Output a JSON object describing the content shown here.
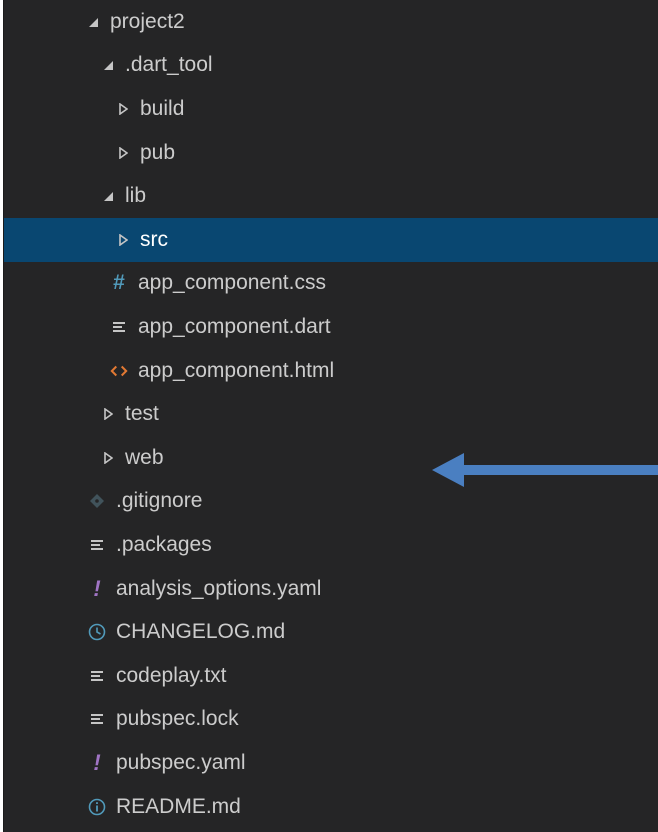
{
  "explorer": {
    "items": [
      {
        "label": "project2",
        "kind": "folder-open",
        "depth": 0
      },
      {
        "label": ".dart_tool",
        "kind": "folder-open",
        "depth": 1
      },
      {
        "label": "build",
        "kind": "folder-closed",
        "depth": 2
      },
      {
        "label": "pub",
        "kind": "folder-closed",
        "depth": 2
      },
      {
        "label": "lib",
        "kind": "folder-open",
        "depth": 1
      },
      {
        "label": "src",
        "kind": "folder-closed",
        "depth": 2,
        "selected": true
      },
      {
        "label": "app_component.css",
        "kind": "file",
        "icon": "hash-icon",
        "depth": 2
      },
      {
        "label": "app_component.dart",
        "kind": "file",
        "icon": "lines-icon",
        "depth": 2
      },
      {
        "label": "app_component.html",
        "kind": "file",
        "icon": "code-brackets-icon",
        "depth": 2
      },
      {
        "label": "test",
        "kind": "folder-closed",
        "depth": 1
      },
      {
        "label": "web",
        "kind": "folder-closed",
        "depth": 1
      },
      {
        "label": ".gitignore",
        "kind": "file",
        "icon": "git-diamond-icon",
        "depth": 1
      },
      {
        "label": ".packages",
        "kind": "file",
        "icon": "lines-icon",
        "depth": 1
      },
      {
        "label": "analysis_options.yaml",
        "kind": "file",
        "icon": "exclamation-icon",
        "depth": 1
      },
      {
        "label": "CHANGELOG.md",
        "kind": "file",
        "icon": "clock-icon",
        "depth": 1
      },
      {
        "label": "codeplay.txt",
        "kind": "file",
        "icon": "lines-icon",
        "depth": 1
      },
      {
        "label": "pubspec.lock",
        "kind": "file",
        "icon": "lines-icon",
        "depth": 1
      },
      {
        "label": "pubspec.yaml",
        "kind": "file",
        "icon": "exclamation-icon",
        "depth": 1
      },
      {
        "label": "README.md",
        "kind": "file",
        "icon": "info-icon",
        "depth": 1
      }
    ]
  },
  "colors": {
    "background": "#252526",
    "selection": "#094771",
    "text": "#cccccc",
    "css_icon": "#519aba",
    "html_icon": "#e37933",
    "yaml_icon": "#a074c4",
    "info_icon": "#519aba",
    "arrow": "#4a7fc1"
  }
}
